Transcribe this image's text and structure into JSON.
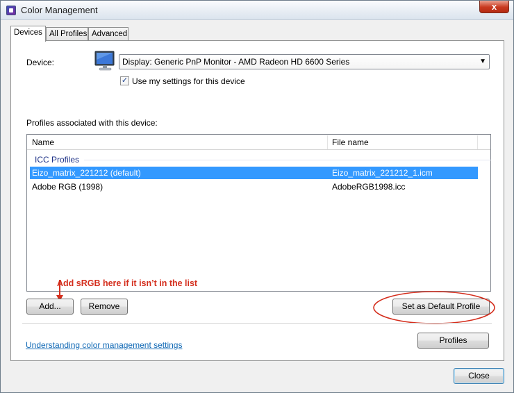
{
  "window": {
    "title": "Color Management",
    "close_glyph": "x"
  },
  "tabs": [
    {
      "label": "Devices",
      "active": true
    },
    {
      "label": "All Profiles",
      "active": false
    },
    {
      "label": "Advanced",
      "active": false
    }
  ],
  "device": {
    "label": "Device:",
    "icon": "monitor-icon",
    "selected": "Display: Generic PnP Monitor - AMD Radeon HD 6600 Series",
    "use_settings_label": "Use my settings for this device",
    "use_settings_checked": true,
    "check_glyph": "✓"
  },
  "profiles": {
    "label": "Profiles associated with this device:",
    "columns": [
      "Name",
      "File name"
    ],
    "group_title": "ICC Profiles",
    "rows": [
      {
        "name": "Eizo_matrix_221212 (default)",
        "file": "Eizo_matrix_221212_1.icm",
        "selected": true
      },
      {
        "name": "Adobe RGB (1998)",
        "file": "AdobeRGB1998.icc",
        "selected": false
      }
    ]
  },
  "buttons": {
    "add": "Add...",
    "remove": "Remove",
    "set_default": "Set as Default Profile",
    "profiles": "Profiles",
    "close": "Close"
  },
  "annotation": {
    "text": "Add sRGB here if it isn’t in the list",
    "color": "#d42e1d"
  },
  "help_link": "Understanding color management settings",
  "colors": {
    "selection": "#3399ff",
    "link": "#0f68b5",
    "group_title": "#1e3287"
  }
}
